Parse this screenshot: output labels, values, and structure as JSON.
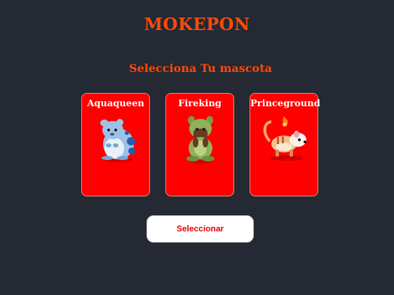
{
  "app": {
    "title": "MOKEPON",
    "subtitle": "Selecciona Tu mascota"
  },
  "pets": [
    {
      "name": "Aquaqueen",
      "icon": "aquaqueen-icon"
    },
    {
      "name": "Fireking",
      "icon": "fireking-icon"
    },
    {
      "name": "Princeground",
      "icon": "princeground-icon"
    }
  ],
  "actions": {
    "select_label": "Seleccionar"
  },
  "colors": {
    "background": "#242933",
    "accent": "#ff4a0a",
    "card": "#ff0000",
    "button_text": "#e00000"
  }
}
